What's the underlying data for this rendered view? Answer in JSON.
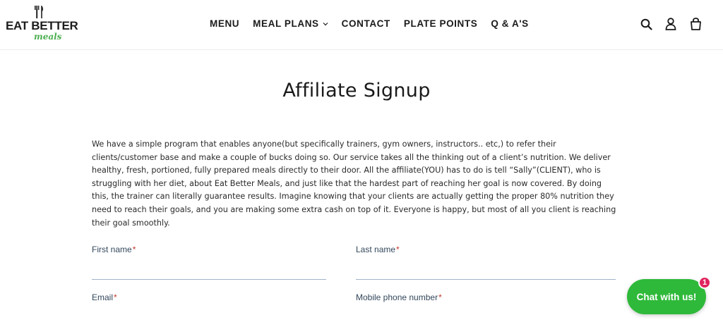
{
  "brand": {
    "name": "EAT BETTER",
    "tagline": "meals",
    "accent_color": "#4caf50"
  },
  "nav": {
    "items": [
      {
        "label": "MENU",
        "has_dropdown": false
      },
      {
        "label": "MEAL PLANS",
        "has_dropdown": true
      },
      {
        "label": "CONTACT",
        "has_dropdown": false
      },
      {
        "label": "PLATE POINTS",
        "has_dropdown": false
      },
      {
        "label": "Q & A'S",
        "has_dropdown": false
      }
    ]
  },
  "header_icons": [
    "search-icon",
    "account-icon",
    "cart-icon"
  ],
  "page": {
    "title": "Affiliate Signup",
    "intro": "We have a simple program that enables anyone(but specifically trainers, gym owners, instructors.. etc,) to refer their clients/customer base and make a couple of bucks doing so. Our service takes all the thinking out of a client’s nutrition. We deliver healthy, fresh, portioned, fully prepared meals directly to their door. All the affiliate(YOU) has to do is tell “Sally”(CLIENT), who is struggling with her diet, about Eat Better Meals, and just like that the hardest part of reaching her goal is now covered. By doing this, the trainer can literally guarantee results. Imagine knowing that your clients are actually getting the proper 80% nutrition they need to reach their goals, and you are making some extra cash on top of it. Everyone is happy, but most of all you client is reaching their goal smoothly."
  },
  "form": {
    "first_name": {
      "label": "First name",
      "required_mark": "*",
      "value": ""
    },
    "last_name": {
      "label": "Last name",
      "required_mark": "*",
      "value": ""
    },
    "email": {
      "label": "Email",
      "required_mark": "*",
      "value": ""
    },
    "phone": {
      "label": "Mobile phone number",
      "required_mark": "*",
      "value": ""
    }
  },
  "chat": {
    "label": "Chat with us!",
    "badge": "1",
    "color": "#2fb93a",
    "badge_color": "#e0245e"
  }
}
